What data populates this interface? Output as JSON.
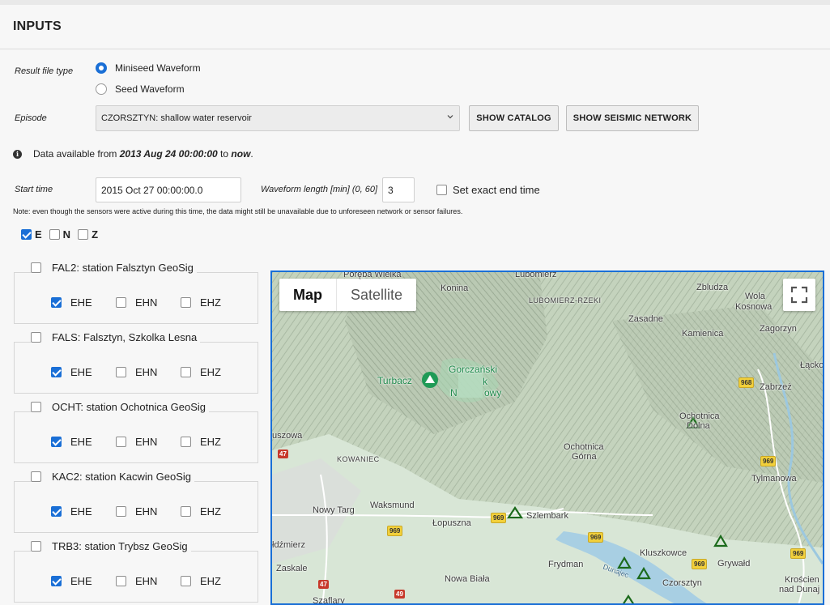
{
  "section_title": "INPUTS",
  "result_file_type": {
    "label": "Result file type",
    "options": [
      {
        "label": "Miniseed Waveform",
        "selected": true
      },
      {
        "label": "Seed Waveform",
        "selected": false
      }
    ]
  },
  "episode": {
    "label": "Episode",
    "selected": "CZORSZTYN: shallow water reservoir"
  },
  "buttons": {
    "show_catalog": "SHOW CATALOG",
    "show_seismic_network": "SHOW SEISMIC NETWORK"
  },
  "availability": {
    "prefix": "Data available from",
    "from": "2013 Aug 24 00:00:00",
    "to_word": "to",
    "to": "now",
    "end": "."
  },
  "start_time": {
    "label": "Start time",
    "value": "2015 Oct 27 00:00:00.0"
  },
  "waveform_length": {
    "label": "Waveform length [min] (0, 60]",
    "value": "3"
  },
  "exact_end_time": {
    "label": "Set exact end time",
    "checked": false
  },
  "note": "Note: even though the sensors were active during this time, the data might still be unavailable due to unforeseen network or sensor failures.",
  "components": [
    {
      "label": "E",
      "checked": true
    },
    {
      "label": "N",
      "checked": false
    },
    {
      "label": "Z",
      "checked": false
    }
  ],
  "stations": [
    {
      "label": "FAL2: station Falsztyn GeoSig",
      "checked": false,
      "channels": [
        {
          "label": "EHE",
          "checked": true
        },
        {
          "label": "EHN",
          "checked": false
        },
        {
          "label": "EHZ",
          "checked": false
        }
      ]
    },
    {
      "label": "FALS: Falsztyn, Szkolka Lesna",
      "checked": false,
      "channels": [
        {
          "label": "EHE",
          "checked": true
        },
        {
          "label": "EHN",
          "checked": false
        },
        {
          "label": "EHZ",
          "checked": false
        }
      ]
    },
    {
      "label": "OCHT: station Ochotnica GeoSig",
      "checked": false,
      "channels": [
        {
          "label": "EHE",
          "checked": true
        },
        {
          "label": "EHN",
          "checked": false
        },
        {
          "label": "EHZ",
          "checked": false
        }
      ]
    },
    {
      "label": "KAC2: station Kacwin GeoSig",
      "checked": false,
      "channels": [
        {
          "label": "EHE",
          "checked": true
        },
        {
          "label": "EHN",
          "checked": false
        },
        {
          "label": "EHZ",
          "checked": false
        }
      ]
    },
    {
      "label": "TRB3: station Trybsz GeoSig",
      "checked": false,
      "channels": [
        {
          "label": "EHE",
          "checked": true
        },
        {
          "label": "EHN",
          "checked": false
        },
        {
          "label": "EHZ",
          "checked": false
        }
      ]
    }
  ],
  "map": {
    "type_buttons": {
      "map": "Map",
      "satellite": "Satellite"
    },
    "places": {
      "poreba": "Poręba Wielka",
      "konina": "Konina",
      "lubomierz": "Lubomierz",
      "lubomierz_rzeki": "LUBOMIERZ-RZEKI",
      "zbludza": "Zbludza",
      "wola_1": "Wola",
      "wola_2": "Kosnowa",
      "zasadne": "Zasadne",
      "kamienica": "Kamienica",
      "zagorzyn": "Zagorzyn",
      "turbacz": "Turbacz",
      "gorczanski_1": "Gorczański",
      "gorczanski_2": "k",
      "gorczanski_3": "N",
      "gorczanski_4": "owy",
      "lacko": "Łącko",
      "zabrzez": "Zabrzeż",
      "ochotnica_dolna_1": "Ochotnica",
      "ochotnica_dolna_2": "Dolna",
      "luszowa": "uszowa",
      "ochotnica_gorna_1": "Ochotnica",
      "ochotnica_gorna_2": "Górna",
      "kowaniec": "KOWANIEC",
      "tylmanowa": "Tylmanowa",
      "nowy_targ": "Nowy Targ",
      "waksmund": "Waksmund",
      "lopuszna": "Łopuszna",
      "szlembark": "Szlembark",
      "ludzmierz": "łdźmierz",
      "kluszkowce": "Kluszkowce",
      "frydman": "Frydman",
      "grywald": "Grywałd",
      "zaskale": "Zaskale",
      "nowa_biala": "Nowa Biała",
      "czorsztyn": "Czorsztyn",
      "kroscienko_1": "Krościen",
      "kroscienko_2": "nad Dunaj",
      "szaflary": "Szaflary",
      "dunajec": "Dunajec"
    },
    "roads": {
      "r47a": "47",
      "r47b": "47",
      "r49": "49",
      "r968": "968",
      "r969a": "969",
      "r969b": "969",
      "r969c": "969",
      "r969d": "969",
      "r969e": "969",
      "r969f": "969"
    }
  }
}
